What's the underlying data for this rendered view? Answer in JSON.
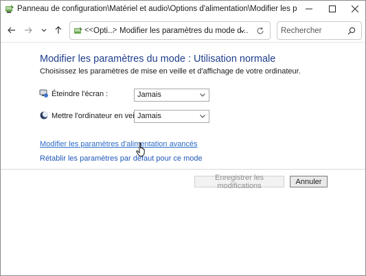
{
  "window": {
    "title": "Panneau de configuration\\Matériel et audio\\Options d'alimentation\\Modifier les paramètres du mode de..."
  },
  "address_bar": {
    "overflow_chevron": "<<",
    "crumb_1": "Opti...",
    "separator": ">",
    "crumb_2": "Modifier les paramètres du mode d..."
  },
  "search": {
    "placeholder": "Rechercher"
  },
  "main": {
    "title": "Modifier les paramètres du mode : Utilisation normale",
    "description": "Choisissez les paramètres de mise en veille et d'affichage de votre ordinateur.",
    "settings": [
      {
        "label": "Éteindre l'écran :",
        "value": "Jamais",
        "icon": "monitor-icon"
      },
      {
        "label": "Mettre l'ordinateur en veille :",
        "value": "Jamais",
        "icon": "moon-icon"
      }
    ],
    "links": {
      "advanced": "Modifier les paramètres d'alimentation avancés",
      "restore": "Rétablir les paramètres par défaut pour ce mode"
    }
  },
  "buttons": {
    "save": "Enregistrer les modifications",
    "cancel": "Annuler"
  },
  "colors": {
    "title_blue": "#1e3d8a",
    "link_blue": "#1f56b8"
  }
}
